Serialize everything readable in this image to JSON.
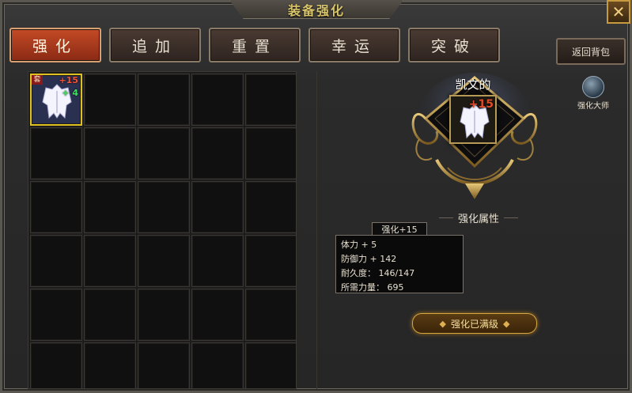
{
  "window": {
    "title": "装备强化",
    "close_label": "✕"
  },
  "tabs": [
    {
      "label": "强化",
      "active": true
    },
    {
      "label": "追加",
      "active": false
    },
    {
      "label": "重置",
      "active": false
    },
    {
      "label": "幸运",
      "active": false
    },
    {
      "label": "突破",
      "active": false
    }
  ],
  "back_button": "返回背包",
  "inventory": {
    "selected_item": {
      "set_badge": "套",
      "enhance_level": "+15",
      "add_level": "+ 4"
    }
  },
  "detail": {
    "item_name": "凯文的",
    "item_enhance": "+15",
    "master_label": "强化大师",
    "attr_heading": "强化属性",
    "stat_tab": "强化+15",
    "stats": [
      "体力 + 5",
      "防御力 + 142",
      "耐久度： 146/147",
      "所需力量： 695"
    ],
    "max_button": "强化已满级"
  },
  "colors": {
    "active_tab": "#c44a26",
    "selected_border": "#e0c020",
    "enhance_red": "#ff5030",
    "add_green": "#40e060",
    "title_gold": "#d8c46a"
  },
  "icons": {
    "close": "close-icon",
    "item": "armor-icon",
    "master": "orb-icon"
  }
}
